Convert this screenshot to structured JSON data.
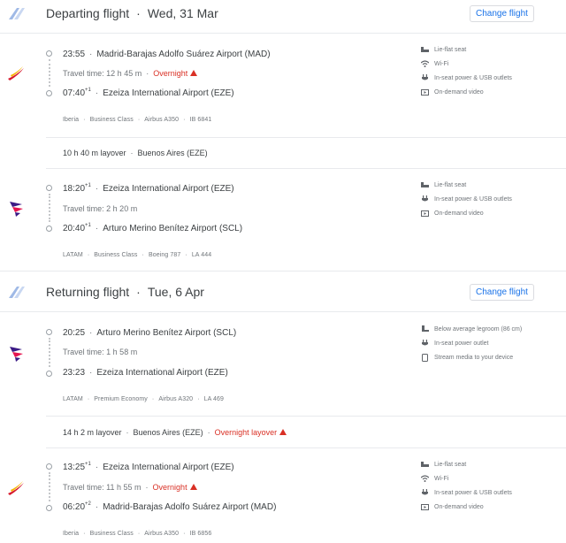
{
  "departing": {
    "title": "Departing flight",
    "date": "Wed, 31 Mar",
    "change_label": "Change flight",
    "segments": [
      {
        "dep_time": "23:55",
        "dep_plus": "",
        "dep_airport": "Madrid-Barajas Adolfo Suárez Airport (MAD)",
        "travel_time": "Travel time: 12 h 45 m",
        "overnight": "Overnight",
        "arr_time": "07:40",
        "arr_plus": "+1",
        "arr_airport": "Ezeiza International Airport (EZE)",
        "airline": "Iberia",
        "cabin": "Business Class",
        "aircraft": "Airbus A350",
        "flight_no": "IB 6841",
        "amenities": [
          "Lie-flat seat",
          "Wi-Fi",
          "In-seat power & USB outlets",
          "On-demand video"
        ]
      },
      {
        "dep_time": "18:20",
        "dep_plus": "+1",
        "dep_airport": "Ezeiza International Airport (EZE)",
        "travel_time": "Travel time: 2 h 20 m",
        "overnight": "",
        "arr_time": "20:40",
        "arr_plus": "+1",
        "arr_airport": "Arturo Merino Benítez Airport (SCL)",
        "airline": "LATAM",
        "cabin": "Business Class",
        "aircraft": "Boeing 787",
        "flight_no": "LA 444",
        "amenities": [
          "Lie-flat seat",
          "In-seat power & USB outlets",
          "On-demand video"
        ]
      }
    ],
    "layover": {
      "duration": "10 h 40 m layover",
      "place": "Buenos Aires (EZE)",
      "note": ""
    }
  },
  "returning": {
    "title": "Returning flight",
    "date": "Tue, 6 Apr",
    "change_label": "Change flight",
    "segments": [
      {
        "dep_time": "20:25",
        "dep_plus": "",
        "dep_airport": "Arturo Merino Benítez Airport (SCL)",
        "travel_time": "Travel time: 1 h 58 m",
        "overnight": "",
        "arr_time": "23:23",
        "arr_plus": "",
        "arr_airport": "Ezeiza International Airport (EZE)",
        "airline": "LATAM",
        "cabin": "Premium Economy",
        "aircraft": "Airbus A320",
        "flight_no": "LA 469",
        "amenities": [
          "Below average legroom (86 cm)",
          "In-seat power outlet",
          "Stream media to your device"
        ]
      },
      {
        "dep_time": "13:25",
        "dep_plus": "+1",
        "dep_airport": "Ezeiza International Airport (EZE)",
        "travel_time": "Travel time: 11 h 55 m",
        "overnight": "Overnight",
        "arr_time": "06:20",
        "arr_plus": "+2",
        "arr_airport": "Madrid-Barajas Adolfo Suárez Airport (MAD)",
        "airline": "Iberia",
        "cabin": "Business Class",
        "aircraft": "Airbus A350",
        "flight_no": "IB 6856",
        "amenities": [
          "Lie-flat seat",
          "Wi-Fi",
          "In-seat power & USB outlets",
          "On-demand video"
        ]
      }
    ],
    "layover": {
      "duration": "14 h 2 m layover",
      "place": "Buenos Aires (EZE)",
      "note": "Overnight layover"
    }
  },
  "colors": {
    "accent": "#1a73e8",
    "warning": "#d93025",
    "iberia_red": "#d7192d",
    "iberia_yellow": "#f7b500",
    "latam_indigo": "#3b1b86",
    "latam_pink": "#e4134f"
  }
}
